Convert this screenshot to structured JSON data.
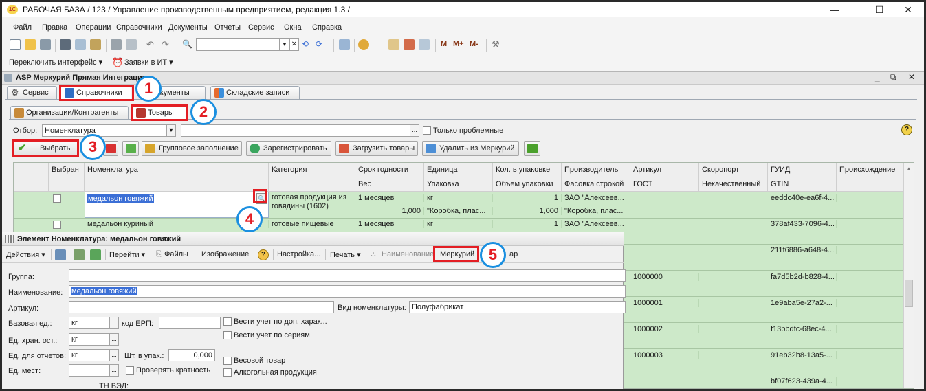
{
  "titlebar": {
    "title": "РАБОЧАЯ БАЗА / 123 /  Управление производственным предприятием, редакция 1.3 /",
    "logo": "1С",
    "minimize": "—",
    "maximize": "☐",
    "close": "✕"
  },
  "menu": [
    "Файл",
    "Правка",
    "Операции",
    "Справочники",
    "Документы",
    "Отчеты",
    "Сервис",
    "Окна",
    "Справка"
  ],
  "toolbar2": {
    "switch_interface": "Переключить интерфейс",
    "requests": "Заявки в ИТ"
  },
  "toolbar1": {
    "m": "M",
    "m_plus": "M+",
    "m_minus": "M-"
  },
  "mainwin": {
    "title": "ASP Меркурий Прямая Интеграция",
    "tabs": [
      "Сервис",
      "Справочники",
      "Документы",
      "Складские записи"
    ],
    "subtabs": [
      "Организации/Контрагенты",
      "Товары"
    ],
    "filter_label": "Отбор:",
    "filter_value": "Номенклатура",
    "only_problem": "Только проблемные",
    "buttons": {
      "select": "Выбрать",
      "group_fill": "Групповое заполнение",
      "register": "Зарегистрировать",
      "load_goods": "Загрузить товары",
      "delete_mercury": "Удалить из Меркурий"
    },
    "help": "?"
  },
  "grid": {
    "headers_top": [
      "Выбран",
      "Номенклатура",
      "Категория",
      "Срок годности",
      "Единица",
      "Кол. в упаковке",
      "Производитель",
      "Артикул",
      "Скоропорт",
      "ГУИД",
      "Происхождение"
    ],
    "headers_bottom": [
      "Вес",
      "Упаковка",
      "Объем упаковки",
      "Фасовка строкой",
      "ГОСТ",
      "Некачественный",
      "GTIN"
    ],
    "row1": {
      "nomenclature": "медальон говяжий",
      "category": "готовая продукция из говядины (1602)",
      "shelf": "1 месяцев",
      "weight": "1,000",
      "unit": "кг",
      "package": "\"Коробка, плас...",
      "qty": "1",
      "volume": "1,000",
      "producer": "ЗАО \"Алексеев...",
      "packing": "\"Коробка, плас...",
      "guid": "eeddc40e-ea6f-4..."
    },
    "row2": {
      "nomenclature": "медальон куриный",
      "category": "готовые пищевые продукты и изделия",
      "shelf": "1 месяцев",
      "unit": "кг",
      "qty": "1",
      "producer": "ЗАО \"Алексеев...",
      "guid": "378af433-7096-4..."
    },
    "more_rows": [
      {
        "article": "",
        "guid": "211f6886-a648-4..."
      },
      {
        "article": "1000000",
        "guid": "fa7d5b2d-b828-4..."
      },
      {
        "article": "1000001",
        "guid": "1e9aba5e-27a2-..."
      },
      {
        "article": "1000002",
        "guid": "f13bbdfc-68ec-4..."
      },
      {
        "article": "1000003",
        "guid": "91eb32b8-13a5-..."
      },
      {
        "article": "",
        "guid": "bf07f623-439a-4..."
      }
    ]
  },
  "child": {
    "title": "Элемент Номенклатура: медальон говяжий",
    "toolbar": {
      "actions": "Действия",
      "go": "Перейти",
      "files": "Файлы",
      "image": "Изображение",
      "settings": "Настройка...",
      "print": "Печать",
      "naming": "Наименование",
      "mercury": "Меркурий",
      "tail": "ар"
    },
    "form": {
      "group_label": "Группа:",
      "name_label": "Наименование:",
      "name_value": "медальон говяжий",
      "article_label": "Артикул:",
      "kind_label": "Вид номенклатуры:",
      "kind_value": "Полуфабрикат",
      "base_unit_label": "Базовая ед.:",
      "base_unit_value": "кг",
      "erp_label": "код ЕРП:",
      "extra_char_label": "Вести учет по доп. харак...",
      "series_label": "Вести учет по сериям",
      "storage_label": "Ед. хран. ост.:",
      "storage_value": "кг",
      "report_label": "Ед. для отчетов:",
      "report_value": "кг",
      "pack_label": "Шт. в упак.:",
      "pack_value": "0,000",
      "weight_label": "Весовой товар",
      "places_label": "Ед. мест:",
      "check_mult_label": "Проверять кратность",
      "alcohol_label": "Алкогольная продукция",
      "tnved_label": "ТН ВЭД:"
    }
  },
  "callouts": [
    "1",
    "2",
    "3",
    "4",
    "5"
  ],
  "colors": {
    "highlight_red": "#e31e24",
    "callout_blue": "#1a8fe0",
    "grid_green": "#cde9c9",
    "selection_blue": "#3b6fd6"
  }
}
